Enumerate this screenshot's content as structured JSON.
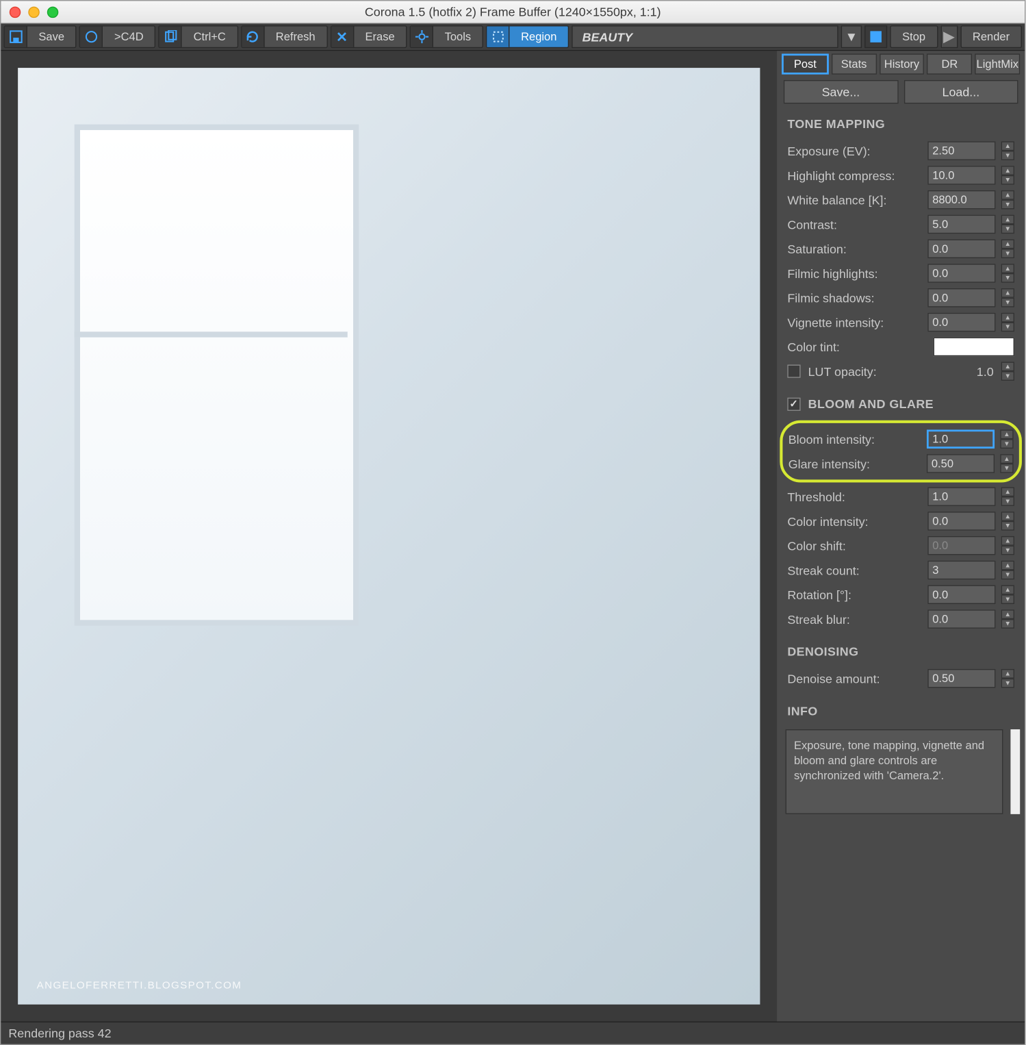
{
  "title": "Corona 1.5 (hotfix 2) Frame Buffer (1240×1550px, 1:1)",
  "toolbar": {
    "save": "Save",
    "c4d": ">C4D",
    "ctrlc": "Ctrl+C",
    "refresh": "Refresh",
    "erase": "Erase",
    "tools": "Tools",
    "region": "Region",
    "pass": "BEAUTY",
    "stop": "Stop",
    "render": "Render"
  },
  "tabs": [
    "Post",
    "Stats",
    "History",
    "DR",
    "LightMix"
  ],
  "buttons": {
    "save": "Save...",
    "load": "Load..."
  },
  "sections": {
    "tone": "TONE MAPPING",
    "bloom": "BLOOM AND GLARE",
    "denoise": "DENOISING",
    "info": "INFO"
  },
  "tone": {
    "exposure_l": "Exposure (EV):",
    "exposure_v": "2.50",
    "highlight_l": "Highlight compress:",
    "highlight_v": "10.0",
    "wb_l": "White balance [K]:",
    "wb_v": "8800.0",
    "contrast_l": "Contrast:",
    "contrast_v": "5.0",
    "sat_l": "Saturation:",
    "sat_v": "0.0",
    "fh_l": "Filmic highlights:",
    "fh_v": "0.0",
    "fs_l": "Filmic shadows:",
    "fs_v": "0.0",
    "vig_l": "Vignette intensity:",
    "vig_v": "0.0",
    "tint_l": "Color tint:",
    "lut_l": "LUT opacity:",
    "lut_v": "1.0"
  },
  "bloom": {
    "bi_l": "Bloom intensity:",
    "bi_v": "1.0",
    "gi_l": "Glare intensity:",
    "gi_v": "0.50",
    "th_l": "Threshold:",
    "th_v": "1.0",
    "ci_l": "Color intensity:",
    "ci_v": "0.0",
    "cs_l": "Color shift:",
    "cs_v": "0.0",
    "sc_l": "Streak count:",
    "sc_v": "3",
    "rot_l": "Rotation [°]:",
    "rot_v": "0.0",
    "sb_l": "Streak blur:",
    "sb_v": "0.0"
  },
  "denoise": {
    "l": "Denoise amount:",
    "v": "0.50"
  },
  "info_text": "Exposure, tone mapping, vignette and bloom and glare controls are synchronized with 'Camera.2'.",
  "watermark": "ANGELOFERRETTI.BLOGSPOT.COM",
  "status": "Rendering pass 42"
}
